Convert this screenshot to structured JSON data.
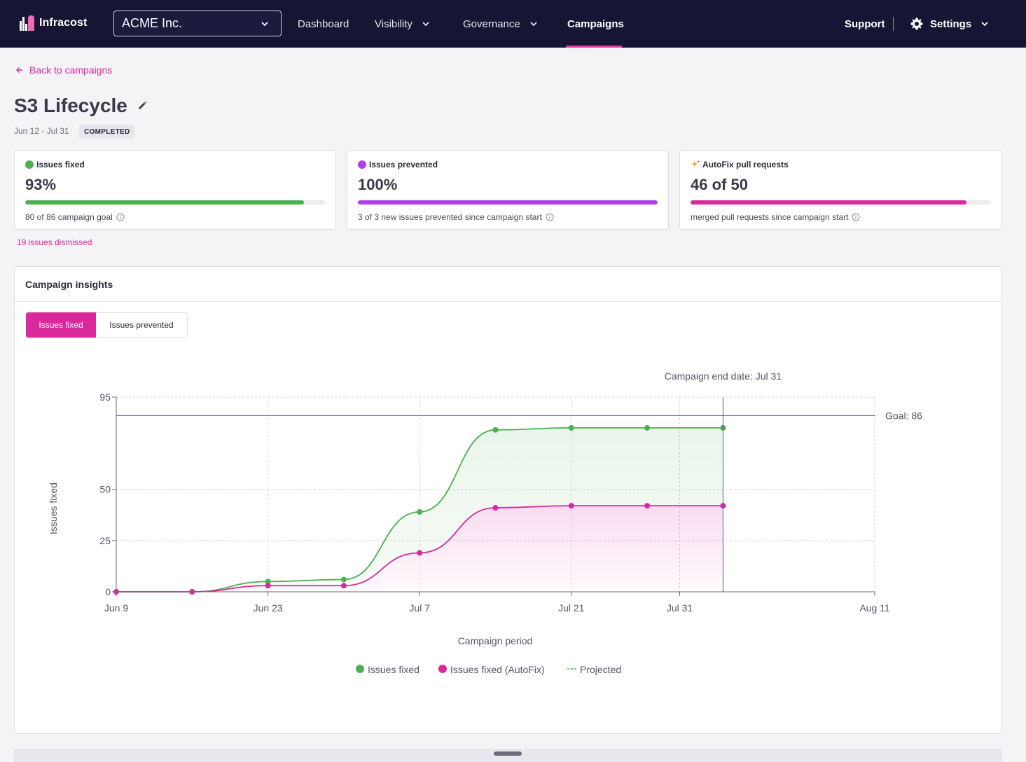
{
  "brand": {
    "name": "Infracost",
    "accent": "#d9299c",
    "nav_bg": "#161634"
  },
  "nav": {
    "org": "ACME Inc.",
    "items": [
      {
        "label": "Dashboard"
      },
      {
        "label": "Visibility"
      },
      {
        "label": "Governance"
      },
      {
        "label": "Campaigns"
      }
    ],
    "support": "Support",
    "settings": "Settings"
  },
  "header": {
    "back": "Back to campaigns",
    "title": "S3 Lifecycle",
    "date_range": "Jun 12 - Jul 31",
    "status": "COMPLETED"
  },
  "stats": [
    {
      "title": "Issues fixed",
      "value": "93%",
      "progress": 0.93,
      "sub": "80 of 86 campaign goal",
      "color": "#4caf50",
      "icon": "green-dot-icon"
    },
    {
      "title": "Issues prevented",
      "value": "100%",
      "progress": 1.0,
      "sub": "3 of 3 new issues prevented since campaign start",
      "color": "#b23cf0",
      "icon": "purple-dot-icon"
    },
    {
      "title": "AutoFix pull requests",
      "value": "46 of 50",
      "progress": 0.92,
      "sub": "merged pull requests since campaign start",
      "color": "#d9299c",
      "icon": "sparkle-icon"
    }
  ],
  "dismissed": "19 issues dismissed",
  "insights": {
    "title": "Campaign insights",
    "tabs": [
      "Issues fixed",
      "Issues prevented"
    ],
    "active_tab": "Issues fixed"
  },
  "chart_data": {
    "type": "area",
    "xlabel": "Campaign period",
    "ylabel": "Issues fixed",
    "x_ticks": [
      "Jun 9",
      "Jun 23",
      "Jul 7",
      "Jul 21",
      "Jul 31",
      "Aug 11"
    ],
    "x_tick_days": [
      0,
      14,
      28,
      42,
      52,
      70
    ],
    "y_ticks": [
      0,
      25,
      50,
      95
    ],
    "ylim": [
      0,
      95
    ],
    "xlim_days": [
      0,
      70
    ],
    "goal": {
      "label": "Goal: 86",
      "value": 86
    },
    "end_marker": {
      "label": "Campaign end date: Jul 31",
      "day": 56
    },
    "series": [
      {
        "name": "Issues fixed",
        "color": "#4caf50",
        "points": [
          [
            0,
            0
          ],
          [
            7,
            0
          ],
          [
            14,
            5
          ],
          [
            21,
            6
          ],
          [
            28,
            39
          ],
          [
            35,
            79
          ],
          [
            42,
            80
          ],
          [
            49,
            80
          ],
          [
            56,
            80
          ]
        ]
      },
      {
        "name": "Issues fixed (AutoFix)",
        "color": "#d9299c",
        "points": [
          [
            0,
            0
          ],
          [
            7,
            0
          ],
          [
            14,
            3
          ],
          [
            21,
            3
          ],
          [
            28,
            19
          ],
          [
            35,
            41
          ],
          [
            42,
            42
          ],
          [
            49,
            42
          ],
          [
            56,
            42
          ]
        ]
      }
    ],
    "legend": [
      {
        "label": "Issues fixed",
        "color": "#4caf50",
        "style": "dot"
      },
      {
        "label": "Issues fixed (AutoFix)",
        "color": "#d9299c",
        "style": "dot"
      },
      {
        "label": "Projected",
        "color": "#4caf50",
        "style": "dash"
      }
    ],
    "grid": true
  }
}
